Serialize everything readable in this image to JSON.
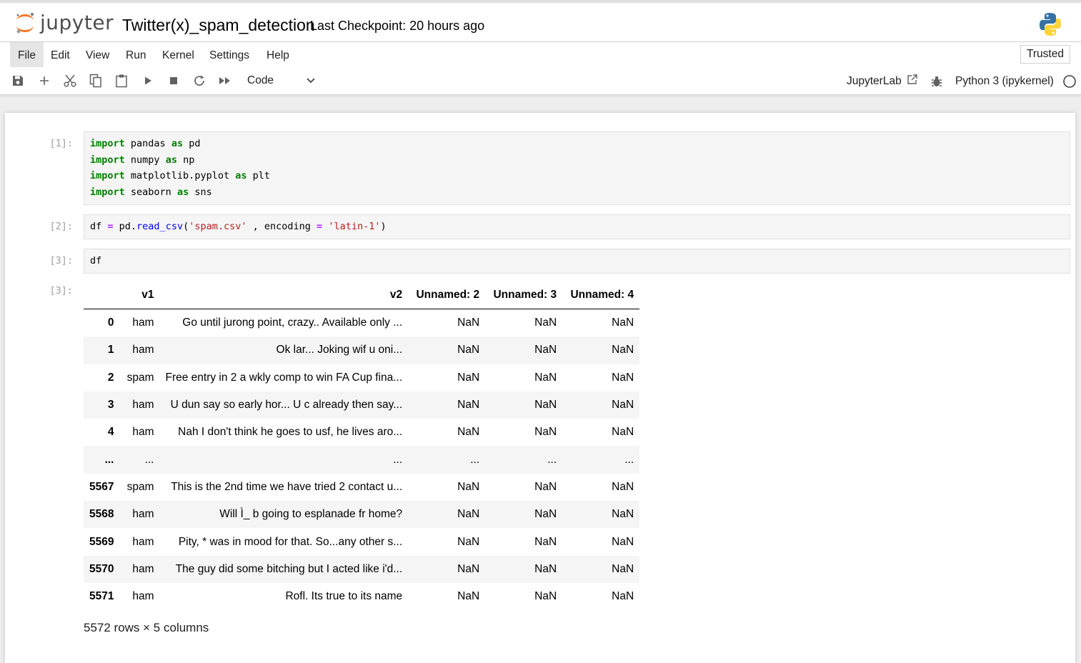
{
  "header": {
    "logo_text": "jupyter",
    "notebook_title": "Twitter(x)_spam_detection",
    "checkpoint": "Last Checkpoint: 20 hours ago"
  },
  "menu": {
    "items": [
      "File",
      "Edit",
      "View",
      "Run",
      "Kernel",
      "Settings",
      "Help"
    ],
    "trusted": "Trusted"
  },
  "toolbar": {
    "icons": [
      "save-icon",
      "plus-icon",
      "scissors-icon",
      "copy-icon",
      "paste-icon",
      "play-icon",
      "stop-icon",
      "restart-icon",
      "fast-forward-icon"
    ],
    "cell_type": "Code",
    "jupyterlab_label": "JupyterLab",
    "kernel_name": "Python 3 (ipykernel)"
  },
  "cells": [
    {
      "prompt": "[1]:"
    },
    {
      "prompt": "[2]:"
    },
    {
      "prompt": "[3]:",
      "code": "df"
    }
  ],
  "output": {
    "prompt": "[3]:",
    "columns": [
      "v1",
      "v2",
      "Unnamed: 2",
      "Unnamed: 3",
      "Unnamed: 4"
    ],
    "rows": [
      {
        "index": "0",
        "cells": [
          "ham",
          "Go until jurong point, crazy.. Available only ...",
          "NaN",
          "NaN",
          "NaN"
        ]
      },
      {
        "index": "1",
        "cells": [
          "ham",
          "Ok lar... Joking wif u oni...",
          "NaN",
          "NaN",
          "NaN"
        ]
      },
      {
        "index": "2",
        "cells": [
          "spam",
          "Free entry in 2 a wkly comp to win FA Cup fina...",
          "NaN",
          "NaN",
          "NaN"
        ]
      },
      {
        "index": "3",
        "cells": [
          "ham",
          "U dun say so early hor... U c already then say...",
          "NaN",
          "NaN",
          "NaN"
        ]
      },
      {
        "index": "4",
        "cells": [
          "ham",
          "Nah I don't think he goes to usf, he lives aro...",
          "NaN",
          "NaN",
          "NaN"
        ]
      },
      {
        "index": "...",
        "cells": [
          "...",
          "...",
          "...",
          "...",
          "..."
        ]
      },
      {
        "index": "5567",
        "cells": [
          "spam",
          "This is the 2nd time we have tried 2 contact u...",
          "NaN",
          "NaN",
          "NaN"
        ]
      },
      {
        "index": "5568",
        "cells": [
          "ham",
          "Will Ì_ b going to esplanade fr home?",
          "NaN",
          "NaN",
          "NaN"
        ]
      },
      {
        "index": "5569",
        "cells": [
          "ham",
          "Pity, * was in mood for that. So...any other s...",
          "NaN",
          "NaN",
          "NaN"
        ]
      },
      {
        "index": "5570",
        "cells": [
          "ham",
          "The guy did some bitching but I acted like i'd...",
          "NaN",
          "NaN",
          "NaN"
        ]
      },
      {
        "index": "5571",
        "cells": [
          "ham",
          "Rofl. Its true to its name",
          "NaN",
          "NaN",
          "NaN"
        ]
      }
    ],
    "shape": "5572 rows × 5 columns"
  },
  "colors": {
    "logo_orange": "#f37726",
    "keyword_green": "#008000",
    "string_red": "#ba2121",
    "function_blue": "#0000ff",
    "operator_purple": "#aa22ff"
  }
}
